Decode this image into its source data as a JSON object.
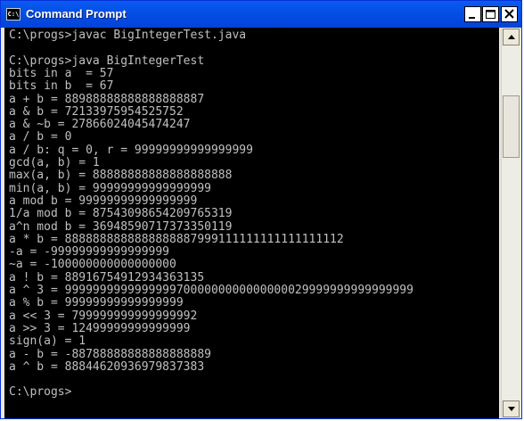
{
  "window": {
    "title": "Command Prompt",
    "icon_label": "C:\\"
  },
  "console": {
    "lines": [
      "C:\\progs>javac BigIntegerTest.java",
      "",
      "C:\\progs>java BigIntegerTest",
      "bits in a  = 57",
      "bits in b  = 67",
      "a + b = 88988888888888888887",
      "a & b = 72133975954525752",
      "a & ~b = 27866024045474247",
      "a / b = 0",
      "a / b: q = 0, r = 99999999999999999",
      "gcd(a, b) = 1",
      "max(a, b) = 88888888888888888888",
      "min(a, b) = 99999999999999999",
      "a mod b = 99999999999999999",
      "1/a mod b = 87543098654209765319",
      "a^n mod b = 36948590717373350119",
      "a * b = 8888888888888888887999111111111111111112",
      "-a = -99999999999999999",
      "~a = -100000000000000000",
      "a ! b = 88916754912934363135",
      "a ^ 3 = 99999999999999997000000000000000029999999999999999",
      "a % b = 99999999999999999",
      "a << 3 = 799999999999999992",
      "a >> 3 = 12499999999999999",
      "sign(a) = 1",
      "a - b = -88788888888888888889",
      "a ^ b = 88844620936979837383",
      "",
      "C:\\progs>"
    ]
  },
  "buttons": {
    "minimize": "minimize",
    "maximize": "maximize",
    "close": "close"
  }
}
